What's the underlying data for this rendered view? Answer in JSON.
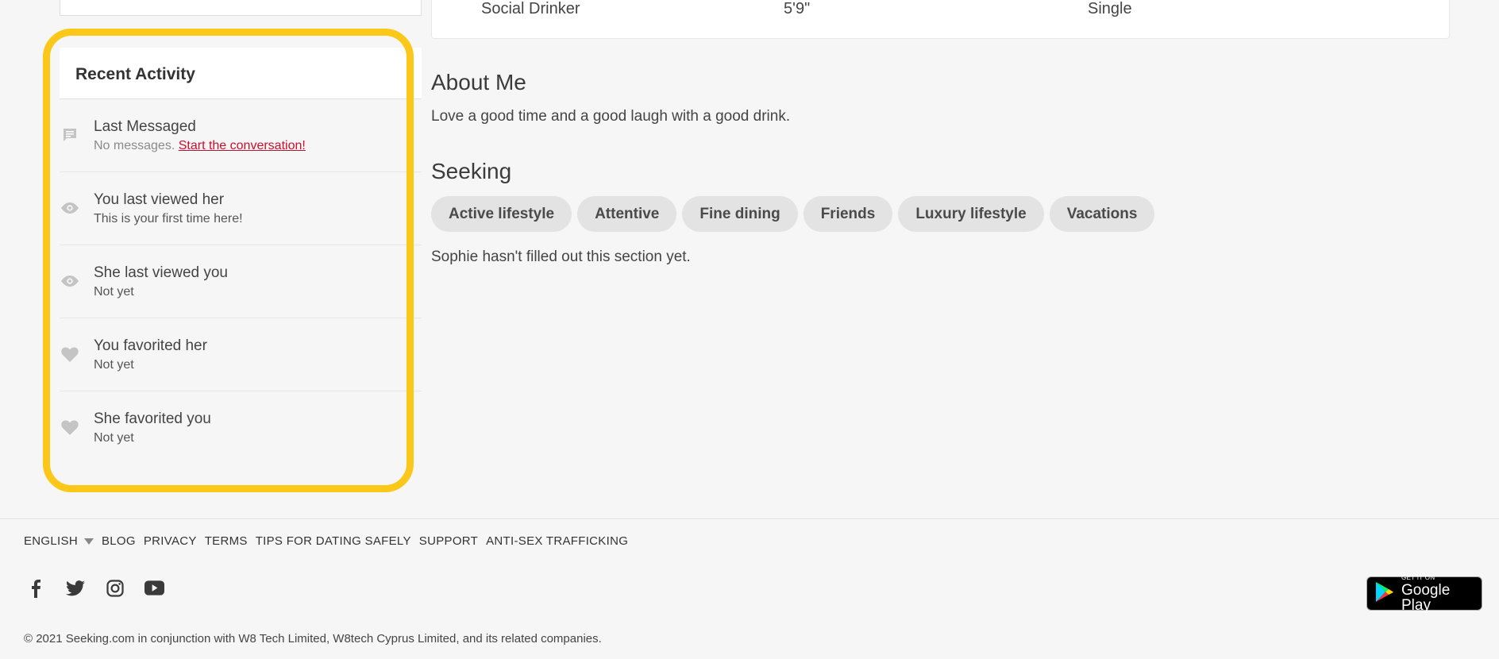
{
  "profile_details": {
    "drinking": "Social Drinker",
    "height": "5'9\"",
    "relationship": "Single"
  },
  "recent_activity": {
    "title": "Recent Activity",
    "items": [
      {
        "icon": "message-icon",
        "title": "Last Messaged",
        "subtitle": "No messages.",
        "link": "Start the conversation!"
      },
      {
        "icon": "eye-icon",
        "title": "You last viewed her",
        "subtitle": "This is your first time here!"
      },
      {
        "icon": "eye-icon",
        "title": "She last viewed you",
        "subtitle": "Not yet"
      },
      {
        "icon": "heart-icon",
        "title": "You favorited her",
        "subtitle": "Not yet"
      },
      {
        "icon": "heart-icon",
        "title": "She favorited you",
        "subtitle": "Not yet"
      }
    ]
  },
  "about": {
    "title": "About Me",
    "text": "Love a good time and a good laugh with a good drink."
  },
  "seeking": {
    "title": "Seeking",
    "tags": [
      "Active lifestyle",
      "Attentive",
      "Fine dining",
      "Friends",
      "Luxury lifestyle",
      "Vacations"
    ],
    "empty_text": "Sophie hasn't filled out this section yet."
  },
  "footer": {
    "language": "ENGLISH",
    "links": [
      "BLOG",
      "PRIVACY",
      "TERMS",
      "TIPS FOR DATING SAFELY",
      "SUPPORT",
      "ANTI-SEX TRAFFICKING"
    ],
    "social": [
      "facebook-icon",
      "twitter-icon",
      "instagram-icon",
      "youtube-icon"
    ],
    "copyright": "© 2021 Seeking.com in conjunction with W8 Tech Limited, W8tech Cyprus Limited, and its related companies.",
    "google_play": {
      "small": "GET IT ON",
      "big": "Google Play"
    }
  },
  "colors": {
    "highlight": "#fbc819",
    "link_red": "#c8102e",
    "tag_bg": "#e3e3e3",
    "icon_gray": "#c4c4c4"
  }
}
